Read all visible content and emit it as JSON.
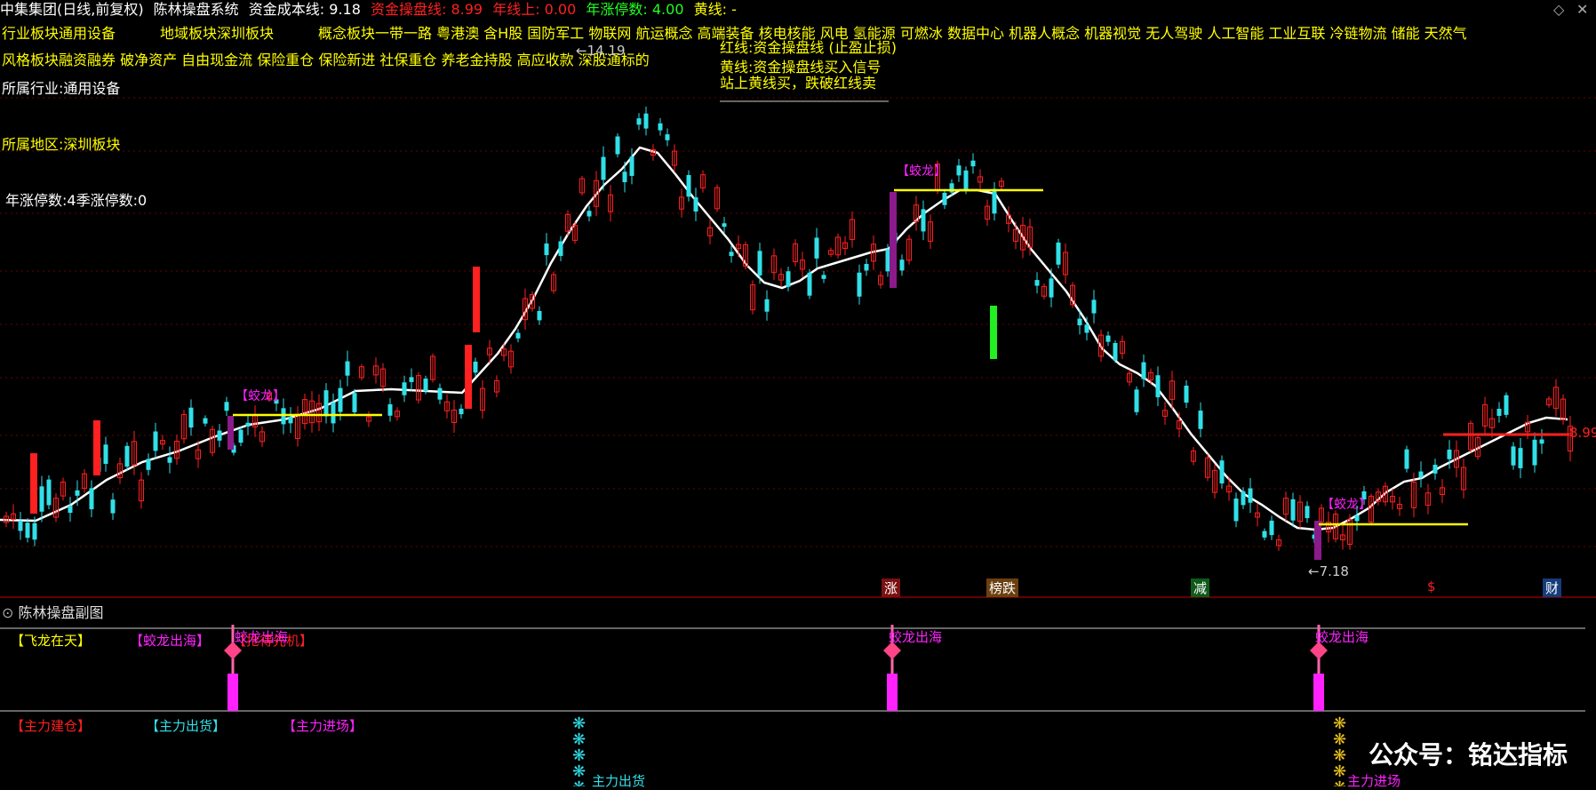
{
  "header": {
    "stock": "中集集团(日线,前复权)",
    "system_name": "陈林操盘系统",
    "cost_line_label": "资金成本线: 9.18",
    "trade_line_label": "资金操盘线: 8.99",
    "year_limit_label": "年线上: 0.00",
    "limit_count_label": "年涨停数: 4.00",
    "yellow_line_label": "黄线: -"
  },
  "info": {
    "row1": {
      "industry_block": "行业板块通用设备",
      "region_block": "地域板块深圳板块",
      "concept_block": "概念板块一带一路 粤港澳 含H股 国防军工 物联网 航运概念 高端装备 核电核能 风电 氢能源 可燃冰 数据中心 机器人概念 机器视觉 无人驾驶 人工智能 工业互联 冷链物流 储能 天然气"
    },
    "row2": "风格板块融资融券 破净资产 自由现金流 保险重仓 保险新进 社保重仓 养老金持股 高应收款 深股通标的",
    "industry": "所属行业:通用设备",
    "region": "所属地区:深圳板块",
    "limit_stats": "年涨停数:4季涨停数:0"
  },
  "legend_tooltip": {
    "line1": "红线:资金操盘线 (止盈止损)",
    "line2": "黄线:资金操盘线买入信号",
    "line3": "站上黄线买，跌破红线卖"
  },
  "price_labels": {
    "high": "14.19",
    "low": "7.18",
    "current": "8.99"
  },
  "chart_tags": {
    "tag1": "【蛟龙】",
    "tag2": "【蛟龙】",
    "tag3": "【蛟龙】"
  },
  "event_markers": {
    "zhang": "涨",
    "bang_die": "榜跌",
    "jian": "减",
    "dollar": "$",
    "cai": "财"
  },
  "subchart": {
    "title": "陈林操盘副图",
    "legend": {
      "fly": "【飞龙在天】",
      "jiaolong": "【蛟龙出海】",
      "first": "【抢得先机】",
      "build": "【主力建仓】",
      "sell": "【主力出货】",
      "enter": "【主力进场】"
    },
    "signals": {
      "s1": "蛟龙出海",
      "s2": "蛟龙出海",
      "s3": "蛟龙出海",
      "s4": "主力出货",
      "s5": "主力进场"
    }
  },
  "watermark": "公众号：铭达指标",
  "colors": {
    "up": "#ff2020",
    "down": "#30e0e8",
    "ma": "#ffffff",
    "yellow": "#ffff00",
    "magenta": "#ff22ff"
  }
}
